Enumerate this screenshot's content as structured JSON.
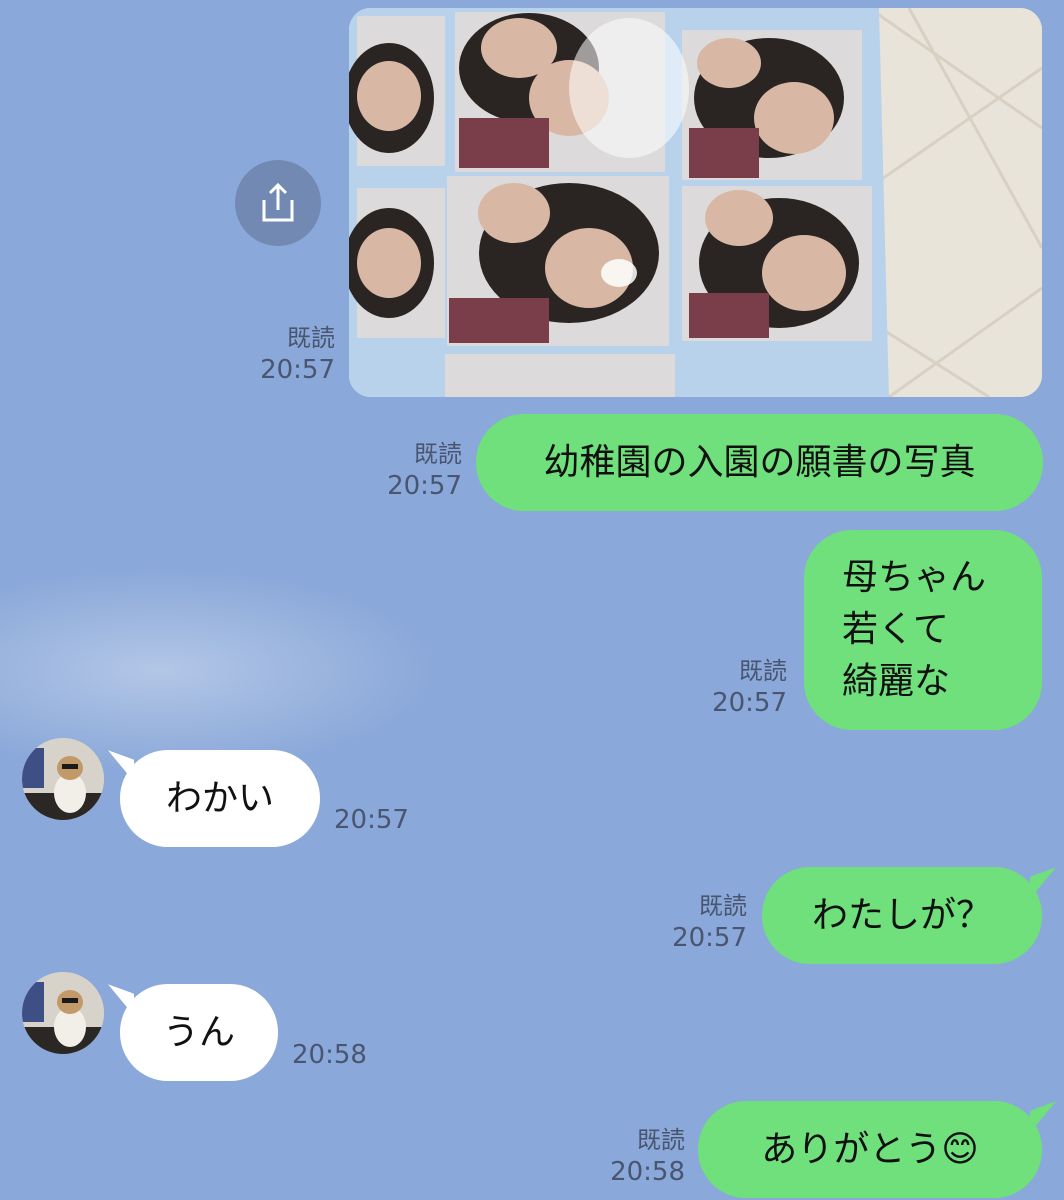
{
  "messages": [
    {
      "type": "image",
      "read": "既読",
      "time": "20:57"
    },
    {
      "type": "text",
      "dir": "out",
      "text": "幼稚園の入園の願書の写真",
      "read": "既読",
      "time": "20:57"
    },
    {
      "type": "text",
      "dir": "out",
      "lines": [
        "母ちゃん",
        "若くて",
        "綺麗な"
      ],
      "read": "既読",
      "time": "20:57"
    },
    {
      "type": "text",
      "dir": "in",
      "text": "わかい",
      "time": "20:57"
    },
    {
      "type": "text",
      "dir": "out",
      "text": "わたしが？",
      "read": "既読",
      "time": "20:57"
    },
    {
      "type": "text",
      "dir": "in",
      "text": "うん",
      "time": "20:58"
    },
    {
      "type": "text",
      "dir": "out",
      "text": "ありがとう",
      "emoji": "😊",
      "read": "既読",
      "time": "20:58"
    }
  ],
  "icons": {
    "share": "share-icon",
    "avatar": "avatar-photo",
    "emoji": "smiling-face-emoji"
  },
  "colors": {
    "background": "#8aa8d9",
    "outgoing": "#6fe07c",
    "incoming": "#ffffff",
    "share_button": "#7189b3"
  }
}
